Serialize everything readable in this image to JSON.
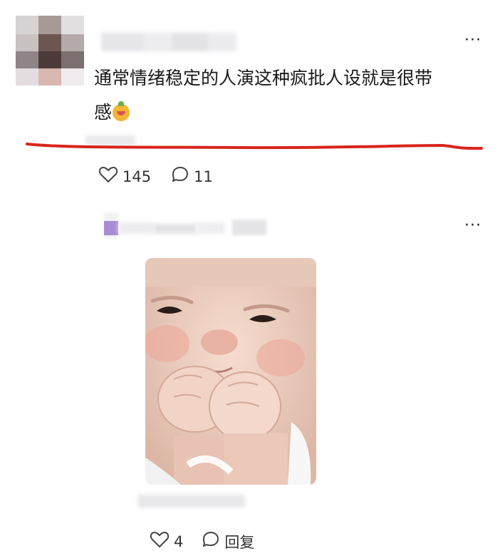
{
  "comment": {
    "text": "通常情绪稳定的人演这种疯批人设就是很带感",
    "emoji_icon": "mandarin-orange-emoji",
    "more_icon": "more-dots-icon",
    "like_count": "145",
    "reply_count": "11",
    "highlight_color": "#d8241b"
  },
  "reply": {
    "more_icon": "more-dots-icon",
    "image_subject": "baby-photo",
    "like_count": "4",
    "reply_label": "回复"
  }
}
